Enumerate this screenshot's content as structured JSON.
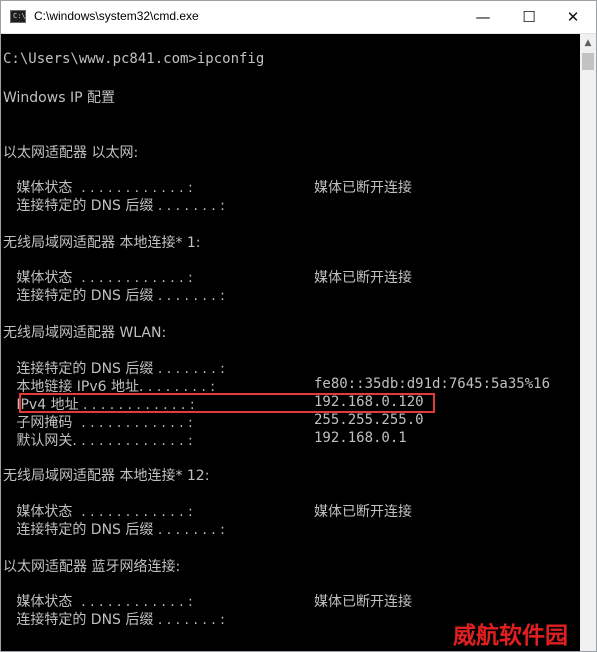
{
  "window": {
    "title": "C:\\windows\\system32\\cmd.exe",
    "icon_label": "C:\\",
    "controls": {
      "minimize": "—",
      "maximize": "☐",
      "close": "✕"
    }
  },
  "console": {
    "prompt": "C:\\Users\\www.pc841.com>ipconfig",
    "header": "Windows IP 配置",
    "adapters": [
      {
        "title": "以太网适配器 以太网:",
        "rows": [
          {
            "label": "   媒体状态  . . . . . . . . . . . . :",
            "value": "媒体已断开连接"
          },
          {
            "label": "   连接特定的 DNS 后缀 . . . . . . . :",
            "value": ""
          }
        ]
      },
      {
        "title": "无线局域网适配器 本地连接* 1:",
        "rows": [
          {
            "label": "   媒体状态  . . . . . . . . . . . . :",
            "value": "媒体已断开连接"
          },
          {
            "label": "   连接特定的 DNS 后缀 . . . . . . . :",
            "value": ""
          }
        ]
      },
      {
        "title": "无线局域网适配器 WLAN:",
        "rows": [
          {
            "label": "   连接特定的 DNS 后缀 . . . . . . . :",
            "value": ""
          },
          {
            "label": "   本地链接 IPv6 地址. . . . . . . . :",
            "value": "fe80::35db:d91d:7645:5a35%16"
          },
          {
            "label": "   IPv4 地址 . . . . . . . . . . . . :",
            "value": "192.168.0.120"
          },
          {
            "label": "   子网掩码  . . . . . . . . . . . . :",
            "value": "255.255.255.0"
          },
          {
            "label": "   默认网关. . . . . . . . . . . . . :",
            "value": "192.168.0.1"
          }
        ]
      },
      {
        "title": "无线局域网适配器 本地连接* 12:",
        "rows": [
          {
            "label": "   媒体状态  . . . . . . . . . . . . :",
            "value": "媒体已断开连接"
          },
          {
            "label": "   连接特定的 DNS 后缀 . . . . . . . :",
            "value": ""
          }
        ]
      },
      {
        "title": "以太网适配器 蓝牙网络连接:",
        "rows": [
          {
            "label": "   媒体状态  . . . . . . . . . . . . :",
            "value": "媒体已断开连接"
          },
          {
            "label": "   连接特定的 DNS 后缀 . . . . . . . :",
            "value": ""
          }
        ]
      }
    ]
  },
  "annotation": {
    "highlight_color": "#e23a3a",
    "highlight_target": "IPv4 地址"
  },
  "watermark": {
    "text": "威航软件园",
    "color": "#e02020"
  },
  "colors": {
    "console_bg": "#000000",
    "console_text": "#c0c0c0",
    "titlebar_bg": "#ffffff"
  }
}
